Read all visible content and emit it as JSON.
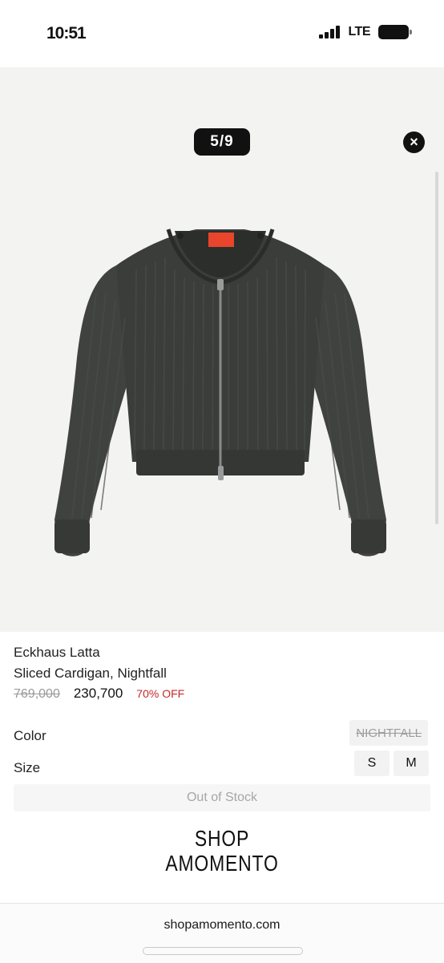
{
  "status": {
    "time": "10:51",
    "network": "LTE"
  },
  "gallery": {
    "counter": "5/9",
    "close_label": "×"
  },
  "product": {
    "brand": "Eckhaus Latta",
    "name": "Sliced Cardigan, Nightfall",
    "original_price": "769,000",
    "sale_price": "230,700",
    "discount": "70% OFF"
  },
  "options": {
    "color_label": "Color",
    "color_value": "NIGHTFALL",
    "size_label": "Size",
    "sizes": [
      "S",
      "M"
    ]
  },
  "stock_status": "Out of Stock",
  "shop_logo": {
    "line1": "SHOP",
    "line2": "AMOMENTO"
  },
  "browser": {
    "url": "shopamomento.com"
  },
  "colors": {
    "garment": "#3c3f3b",
    "discount": "#c62828",
    "label": "#e8452c"
  }
}
